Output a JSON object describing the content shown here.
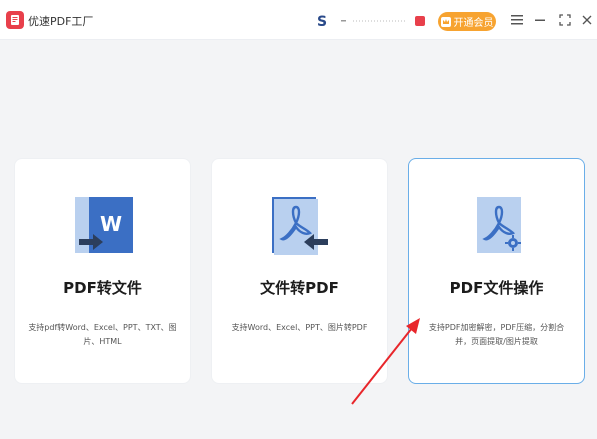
{
  "app": {
    "title": "优速PDF工厂",
    "vip_label": "开通会员"
  },
  "colors": {
    "brand": "#e8404b",
    "vip": "#f7a330",
    "doc_blue": "#3b6fc4",
    "doc_light": "#b9d0ef",
    "active_border": "#6aaee8",
    "annotation_arrow": "#e8262b"
  },
  "window_controls": [
    "menu-icon",
    "minimize-icon",
    "maximize-icon",
    "close-icon"
  ],
  "cards": [
    {
      "title": "PDF转文件",
      "desc": "支持pdf转Word、Excel、PPT、TXT、图片、HTML",
      "icon": "pdf-to-word-icon"
    },
    {
      "title": "文件转PDF",
      "desc": "支持Word、Excel、PPT、图片转PDF",
      "icon": "file-to-pdf-icon"
    },
    {
      "title": "PDF文件操作",
      "desc": "支持PDF加密解密，PDF压缩，分割合并，页面提取/图片提取",
      "icon": "pdf-operations-icon",
      "active": true
    }
  ]
}
